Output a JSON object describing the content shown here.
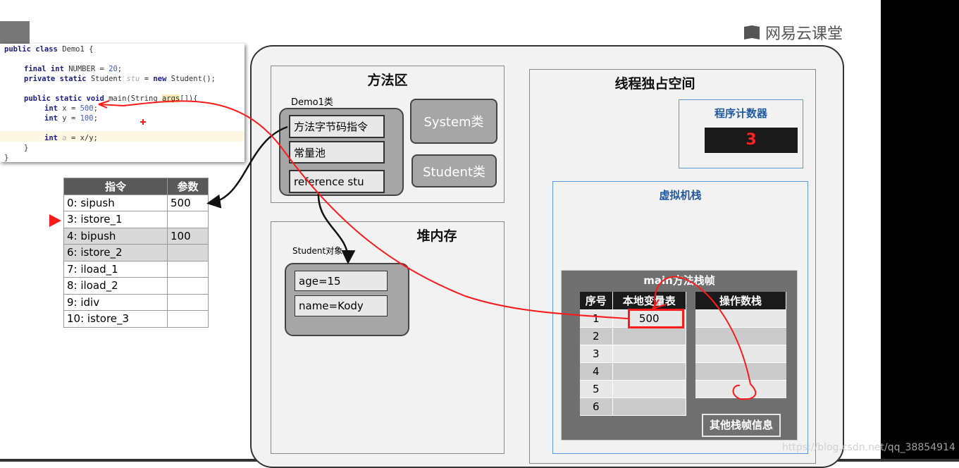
{
  "logo": {
    "text": "网易云课堂"
  },
  "code": {
    "lines": [
      {
        "parts": [
          [
            "kw",
            "public class "
          ],
          [
            "",
            "Demo1 {"
          ]
        ]
      },
      {
        "parts": [
          [
            "kw",
            "final int "
          ],
          [
            "",
            "NUMBER = "
          ],
          [
            "num",
            "20"
          ],
          [
            "",
            ";"
          ]
        ]
      },
      {
        "parts": [
          [
            "kw",
            "private static "
          ],
          [
            "",
            "Student "
          ],
          [
            "it",
            "stu"
          ],
          [
            "",
            " = "
          ],
          [
            "kw",
            "new "
          ],
          [
            "",
            "Student();"
          ]
        ]
      },
      {
        "parts": [
          [
            "kw",
            "public static void "
          ],
          [
            "",
            "main(String "
          ],
          [
            "hl",
            "args"
          ],
          [
            "",
            "[]){"
          ]
        ]
      },
      {
        "parts": [
          [
            "kw",
            "int "
          ],
          [
            "",
            "x = "
          ],
          [
            "num",
            "500"
          ],
          [
            "",
            ";"
          ]
        ]
      },
      {
        "parts": [
          [
            "kw",
            "int "
          ],
          [
            "",
            "y = "
          ],
          [
            "num",
            "100"
          ],
          [
            "",
            ";"
          ]
        ]
      },
      {
        "parts": [
          [
            "kw",
            "int "
          ],
          [
            "it",
            "a"
          ],
          [
            "",
            " = x/y;"
          ]
        ]
      },
      {
        "parts": [
          [
            "",
            "}"
          ]
        ]
      },
      {
        "parts": [
          [
            "",
            "}"
          ]
        ]
      }
    ]
  },
  "instructions": {
    "headers": [
      "指令",
      "参数"
    ],
    "rows": [
      [
        "0: sipush",
        "500"
      ],
      [
        "3: istore_1",
        ""
      ],
      [
        "4: bipush",
        "100"
      ],
      [
        "6: istore_2",
        ""
      ],
      [
        "7: iload_1",
        ""
      ],
      [
        "8: iload_2",
        ""
      ],
      [
        "9: idiv",
        ""
      ],
      [
        "10: istore_3",
        ""
      ]
    ],
    "current_index": 1
  },
  "method_area": {
    "title": "方法区",
    "class_label": "Demo1类",
    "items": [
      "方法字节码指令",
      "常量池",
      "reference stu"
    ],
    "classes": [
      "System类",
      "Student类"
    ]
  },
  "heap": {
    "title": "堆内存",
    "object_label": "Student对象",
    "fields": [
      "age=15",
      "name=Kody"
    ]
  },
  "thread": {
    "title": "线程独占空间",
    "pc": {
      "title": "程序计数器",
      "value": "3"
    },
    "vm_stack": {
      "title": "虚拟机栈",
      "frame": {
        "title": "main方法栈帧",
        "locals": {
          "headers": [
            "序号",
            "本地变量表"
          ],
          "rows": [
            [
              "1",
              "500"
            ],
            [
              "2",
              ""
            ],
            [
              "3",
              ""
            ],
            [
              "4",
              ""
            ],
            [
              "5",
              ""
            ],
            [
              "6",
              ""
            ]
          ]
        },
        "operand_stack": {
          "header": "操作数栈",
          "rows": [
            "",
            "",
            "",
            "",
            ""
          ]
        },
        "other_button": "其他栈帧信息"
      }
    }
  },
  "watermark": "https://blog.csdn.net/qq_38854914",
  "colors": {
    "annotation": "#ff0000",
    "pc_bg": "#1a1a1a",
    "header": "#595959",
    "panel_border_blue": "#5b9bd5"
  }
}
